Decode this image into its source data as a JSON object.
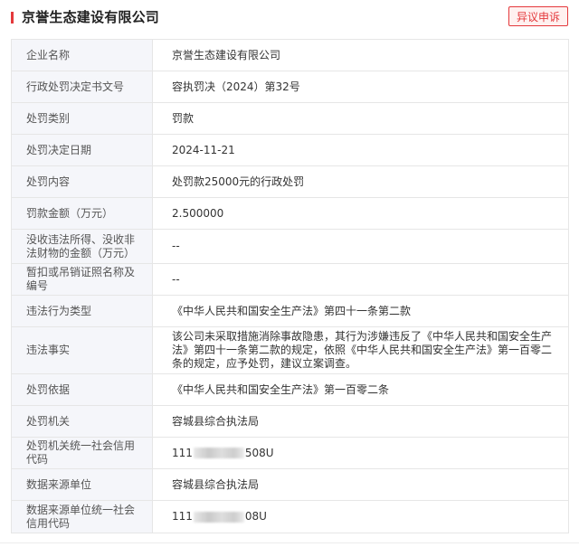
{
  "header": {
    "title": "京誉生态建设有限公司",
    "appeal_label": "异议申诉",
    "accent_color": "#e4393c"
  },
  "rows": [
    {
      "label": "企业名称",
      "value": "京誉生态建设有限公司"
    },
    {
      "label": "行政处罚决定书文号",
      "value": "容执罚决（2024）第32号"
    },
    {
      "label": "处罚类别",
      "value": "罚款"
    },
    {
      "label": "处罚决定日期",
      "value": "2024-11-21"
    },
    {
      "label": "处罚内容",
      "value": "处罚款25000元的行政处罚"
    },
    {
      "label": "罚款金额（万元）",
      "value": "2.500000"
    },
    {
      "label": "没收违法所得、没收非法财物的金额（万元）",
      "value": "--"
    },
    {
      "label": "暂扣或吊销证照名称及编号",
      "value": "--"
    },
    {
      "label": "违法行为类型",
      "value": "《中华人民共和国安全生产法》第四十一条第二款"
    },
    {
      "label": "违法事实",
      "value": "该公司未采取措施消除事故隐患，其行为涉嫌违反了《中华人民共和国安全生产法》第四十一条第二款的规定，依照《中华人民共和国安全生产法》第一百零二条的规定，应予处罚，建议立案调查。"
    },
    {
      "label": "处罚依据",
      "value": "《中华人民共和国安全生产法》第一百零二条"
    },
    {
      "label": "处罚机关",
      "value": "容城县综合执法局"
    },
    {
      "label": "处罚机关统一社会信用代码",
      "value_prefix": "111",
      "value_suffix": "508U"
    },
    {
      "label": "数据来源单位",
      "value": "容城县综合执法局"
    },
    {
      "label": "数据来源单位统一社会信用代码",
      "value_prefix": "111",
      "value_suffix": "08U"
    }
  ]
}
